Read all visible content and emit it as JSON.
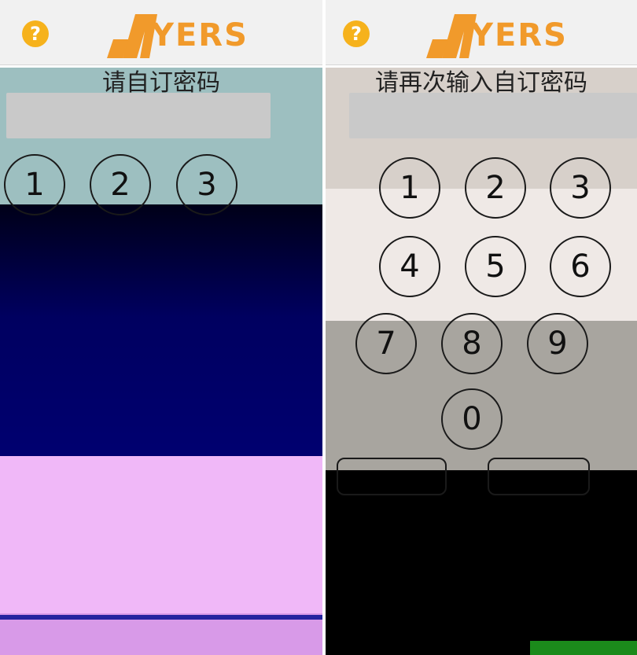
{
  "left": {
    "logo_text": "YERS",
    "help_symbol": "?",
    "prompt": "请自订密码",
    "keys": [
      "1",
      "2",
      "3"
    ]
  },
  "right": {
    "logo_text": "YERS",
    "help_symbol": "?",
    "prompt": "请再次输入自订密码",
    "keys": [
      "1",
      "2",
      "3",
      "4",
      "5",
      "6",
      "7",
      "8",
      "9",
      "0"
    ]
  },
  "colors": {
    "accent": "#f19a2b",
    "help": "#f6b21c"
  },
  "icons": {
    "help": "question-mark-icon",
    "logo": "ayers-logo"
  }
}
